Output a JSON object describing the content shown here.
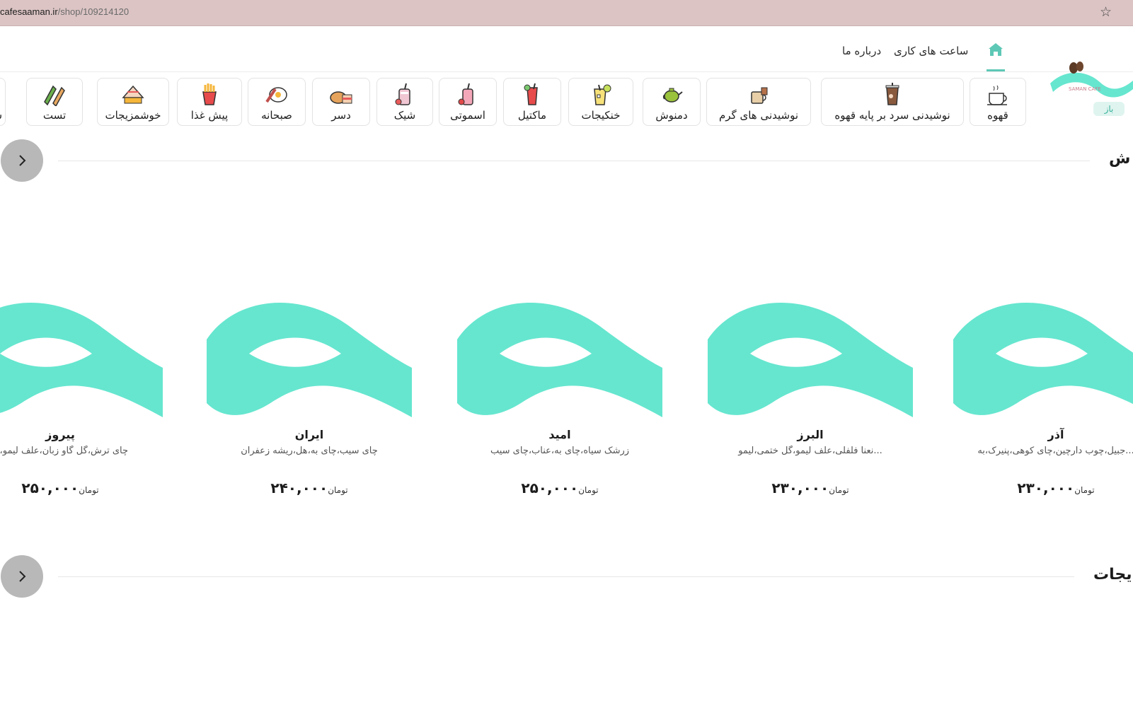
{
  "browser": {
    "url_host": "cafesaaman.ir",
    "url_path": "/shop/109214120"
  },
  "nav": {
    "links": [
      "ساعت های کاری",
      "درباره ما"
    ]
  },
  "header": {
    "status_badge": "باز"
  },
  "categories": [
    {
      "label": "قهوه",
      "icon": "coffee-cup-icon"
    },
    {
      "label": "نوشیدنی سرد بر پایه قهوه",
      "icon": "iced-coffee-icon"
    },
    {
      "label": "نوشیدنی های گرم",
      "icon": "hot-drink-icon"
    },
    {
      "label": "دمنوش",
      "icon": "teapot-icon"
    },
    {
      "label": "خنکیجات",
      "icon": "cold-drink-icon"
    },
    {
      "label": "ماکتیل",
      "icon": "mocktail-icon"
    },
    {
      "label": "اسموتی",
      "icon": "smoothie-icon"
    },
    {
      "label": "شیک",
      "icon": "shake-icon"
    },
    {
      "label": "دسر",
      "icon": "dessert-icon"
    },
    {
      "label": "صبحانه",
      "icon": "breakfast-icon"
    },
    {
      "label": "پیش غذا",
      "icon": "fries-icon"
    },
    {
      "label": "خوشمزیجات",
      "icon": "cake-icon"
    },
    {
      "label": "تست",
      "icon": "toast-sandwich-icon"
    },
    {
      "label": "س",
      "icon": ""
    }
  ],
  "sections": [
    {
      "title": "ش"
    },
    {
      "title": "یجات"
    }
  ],
  "products": [
    {
      "name": "آذر",
      "desc": "جبیل،چوب دارچین،چای کوهی،پنیرک،به...",
      "price": "۲۳۰,۰۰۰",
      "currency": "تومان"
    },
    {
      "name": "البرز",
      "desc": "نعنا فلفلی،علف لیمو،گل ختمی،لیمو...",
      "price": "۲۳۰,۰۰۰",
      "currency": "تومان"
    },
    {
      "name": "امید",
      "desc": "زرشک سیاه،چای به،عناب،چای سیب",
      "price": "۲۵۰,۰۰۰",
      "currency": "تومان"
    },
    {
      "name": "ایران",
      "desc": "چای سیب،چای به،هل،ریشه زعفران",
      "price": "۲۴۰,۰۰۰",
      "currency": "تومان"
    },
    {
      "name": "پیروز",
      "desc": "چای ترش،گل گاو زبان،علف لیمو،به",
      "price": "۲۵۰,۰۰۰",
      "currency": "تومان"
    }
  ],
  "colors": {
    "accent": "#66e6cf",
    "url_bar": "#dcc4c4",
    "arrow_button": "#b8b8b8"
  }
}
